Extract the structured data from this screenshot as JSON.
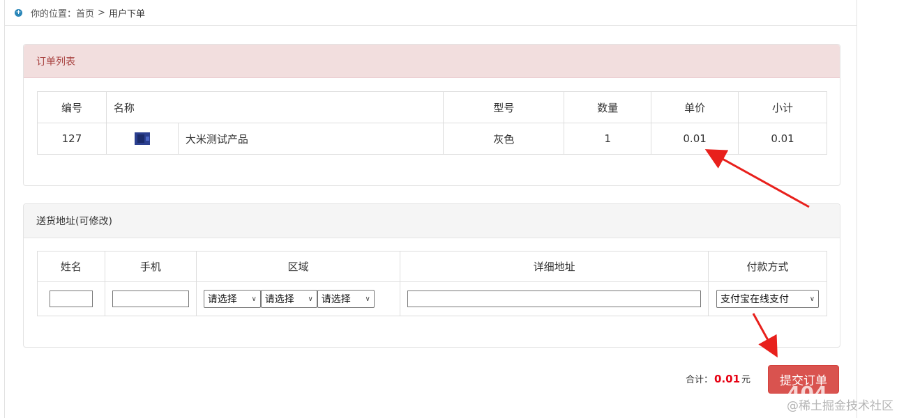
{
  "breadcrumb": {
    "prefix": "你的位置：",
    "home": "首页",
    "separator": ">",
    "current": "用户下单",
    "icon": "plus-circle-icon"
  },
  "orders_panel": {
    "title": "订单列表",
    "headers": [
      "编号",
      "名称",
      "型号",
      "数量",
      "单价",
      "小计"
    ],
    "rows": [
      {
        "id": "127",
        "name": "大米测试产品",
        "model": "灰色",
        "quantity": "1",
        "unit_price": "0.01",
        "subtotal": "0.01"
      }
    ]
  },
  "address_panel": {
    "title": "送货地址(可修改)",
    "headers": [
      "姓名",
      "手机",
      "区域",
      "详细地址",
      "付款方式"
    ],
    "name_value": "",
    "phone_value": "",
    "detail_value": "",
    "region_selects": [
      "请选择",
      "请选择",
      "请选择"
    ],
    "payment_method": "支付宝在线支付"
  },
  "footer": {
    "total_label": "合计：",
    "total_amount": "0.01",
    "currency": "元",
    "submit_label": "提交订单"
  },
  "watermark": {
    "text": "@稀土掘金技术社区",
    "number": "404"
  },
  "colors": {
    "danger_panel_bg": "#f2dede",
    "danger_panel_text": "#a94442",
    "button": "#d9534f",
    "price_red": "#e60012",
    "arrow": "#e8201c"
  }
}
